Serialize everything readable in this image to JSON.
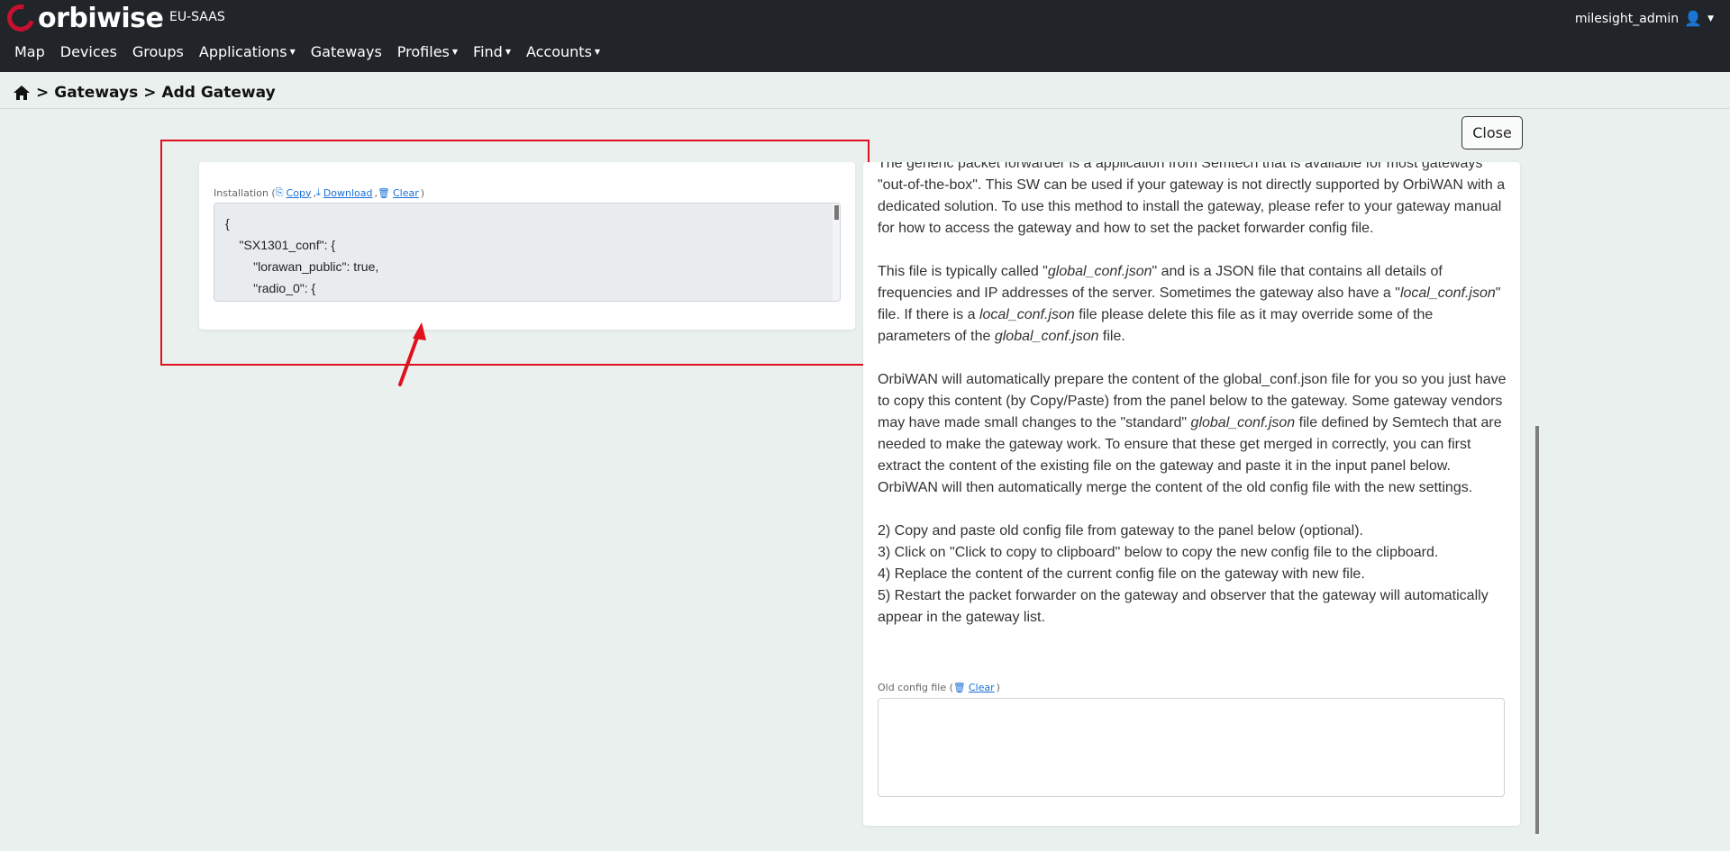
{
  "header": {
    "logo_text": "orbiwise",
    "tenant": "EU-SAAS",
    "username": "milesight_admin",
    "nav": [
      {
        "label": "Map",
        "dropdown": false
      },
      {
        "label": "Devices",
        "dropdown": false
      },
      {
        "label": "Groups",
        "dropdown": false
      },
      {
        "label": "Applications",
        "dropdown": true
      },
      {
        "label": "Gateways",
        "dropdown": false
      },
      {
        "label": "Profiles",
        "dropdown": true
      },
      {
        "label": "Find",
        "dropdown": true
      },
      {
        "label": "Accounts",
        "dropdown": true
      }
    ]
  },
  "breadcrumb": {
    "separator": ">",
    "items": [
      "Gateways",
      "Add Gateway"
    ]
  },
  "close_label": "Close",
  "installation": {
    "label": "Installation",
    "copy": "Copy",
    "download": "Download",
    "clear": "Clear",
    "code_lines": [
      "{",
      "    \"SX1301_conf\": {",
      "        \"lorawan_public\": true,",
      "        \"radio_0\": {"
    ]
  },
  "instructions": {
    "para1_cut": "The generic packet forwarder is a application from Semtech that is available for most gateways \"out-of-the-box\". This SW can be used if your gateway is not directly supported by OrbiWAN with a dedicated solution. To use this method to install the gateway, please refer to your gateway manual for how to access the gateway and how to set the packet forwarder config file.",
    "para2": {
      "t1": "This file is typically called \"",
      "e1": "global_conf.json",
      "t2": "\" and is a JSON file that contains all details of frequencies and IP addresses of the server. Sometimes the gateway also have a \"",
      "e2": "local_conf.json",
      "t3": "\" file. If there is a ",
      "e3": "local_conf.json",
      "t4": " file please delete this file as it may override some of the parameters of the ",
      "e4": "global_conf.json",
      "t5": " file."
    },
    "para3": {
      "t1": "OrbiWAN will automatically prepare the content of the global_conf.json file for you so you just have to copy this content (by Copy/Paste) from the panel below to the gateway. Some gateway vendors may have made small changes to the \"standard\" ",
      "e1": "global_conf.json",
      "t2": " file defined by Semtech that are needed to make the gateway work. To ensure that these get merged in correctly, you can first extract the content of the existing file on the gateway and paste it in the input panel below. OrbiWAN will then automatically merge the content of the old config file with the new settings."
    },
    "steps": [
      "2) Copy and paste old config file from gateway to the panel below (optional).",
      "3) Click on \"Click to copy to clipboard\" below to copy the new config file to the clipboard.",
      "4) Replace the content of the current config file on the gateway with new file.",
      "5) Restart the packet forwarder on the gateway and observer that the gateway will automatically appear in the gateway list."
    ]
  },
  "old_config": {
    "label": "Old config file",
    "clear": "Clear",
    "value": ""
  },
  "colors": {
    "topbar": "#212529",
    "brand_red": "#c8102e",
    "highlight": "#e0101e",
    "link": "#1a6fd6"
  }
}
